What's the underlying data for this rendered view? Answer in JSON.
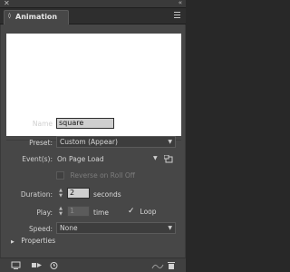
{
  "window": {
    "close_glyph": "✕",
    "collapse_glyph": "«"
  },
  "panel": {
    "title": "Animation",
    "tab_chevron": "◊",
    "menu_icon": "hamburger-icon"
  },
  "form": {
    "name_label": "Name",
    "name_value": "square",
    "preset_label": "Preset:",
    "preset_value": "Custom (Appear)",
    "events_label": "Event(s):",
    "events_value": "On Page Load",
    "reverse_label": "Reverse on Roll Off",
    "duration_label": "Duration:",
    "duration_value": "2",
    "duration_unit": "seconds",
    "play_label": "Play:",
    "play_value": "1",
    "play_unit": "time",
    "loop_label": "Loop",
    "loop_checked": true,
    "speed_label": "Speed:",
    "speed_value": "None"
  },
  "properties": {
    "label": "Properties"
  },
  "footer": {
    "icons": [
      "preview-icon",
      "play-forward-icon",
      "clock-icon",
      "motion-path-icon",
      "trash-icon"
    ]
  },
  "colors": {
    "panel_bg": "#474747",
    "preview_bg": "#ffffff",
    "field_bg": "#cfcfcf"
  }
}
